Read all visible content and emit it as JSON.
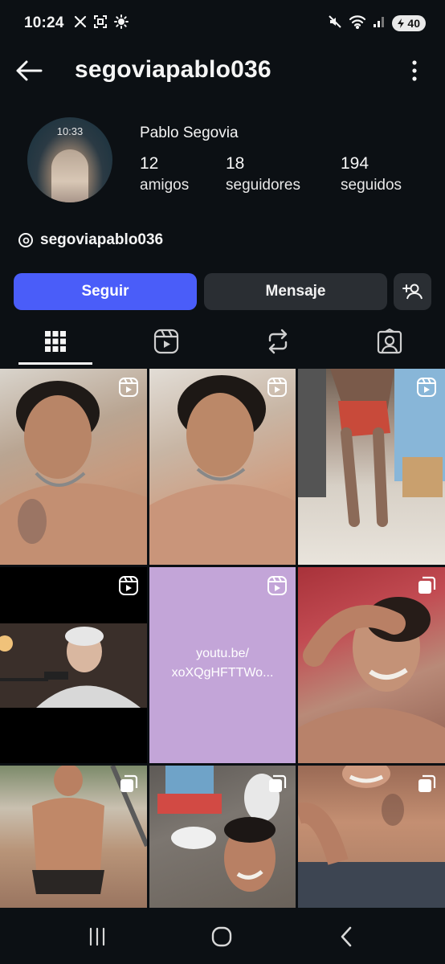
{
  "status_bar": {
    "time": "10:24",
    "left_icons": [
      "x-icon",
      "screenshot-icon",
      "brightness-icon"
    ],
    "right_icons": [
      "mute-icon",
      "wifi-icon",
      "signal-icon"
    ],
    "battery": "40"
  },
  "header": {
    "username": "segoviapablo036",
    "back_icon": "arrow-left-icon",
    "more_icon": "more-vertical-icon"
  },
  "profile": {
    "avatar_time": "10:33",
    "display_name": "Pablo Segovia",
    "stats": [
      {
        "count": "12",
        "label": "amigos"
      },
      {
        "count": "18",
        "label": "seguidores"
      },
      {
        "count": "194",
        "label": "seguidos"
      }
    ],
    "threads_handle": "segoviapablo036"
  },
  "actions": {
    "follow": "Seguir",
    "message": "Mensaje",
    "suggest_icon": "add-person-icon"
  },
  "tabs": [
    {
      "name": "grid",
      "icon": "grid-icon",
      "active": true
    },
    {
      "name": "reels",
      "icon": "reels-icon",
      "active": false
    },
    {
      "name": "reposts",
      "icon": "repost-icon",
      "active": false
    },
    {
      "name": "tagged",
      "icon": "tagged-icon",
      "active": false
    }
  ],
  "posts": [
    {
      "type": "reel",
      "desc": "shirtless man selfie"
    },
    {
      "type": "reel",
      "desc": "shirtless man selfie"
    },
    {
      "type": "reel",
      "desc": "man jumping outdoors"
    },
    {
      "type": "reel",
      "desc": "older man at microphone"
    },
    {
      "type": "reel",
      "text_line1": "youtu.be/",
      "text_line2": "xoXQgHFTTWo..."
    },
    {
      "type": "carousel",
      "desc": "man smiling"
    },
    {
      "type": "carousel",
      "desc": "shirtless man standing"
    },
    {
      "type": "carousel",
      "desc": "man on floor"
    },
    {
      "type": "carousel",
      "desc": "shirtless man selfie"
    }
  ],
  "colors": {
    "background": "#0c1014",
    "follow_button": "#4a5df9",
    "secondary_button": "#2a2e33",
    "link_tile": "#c3a5d8"
  }
}
